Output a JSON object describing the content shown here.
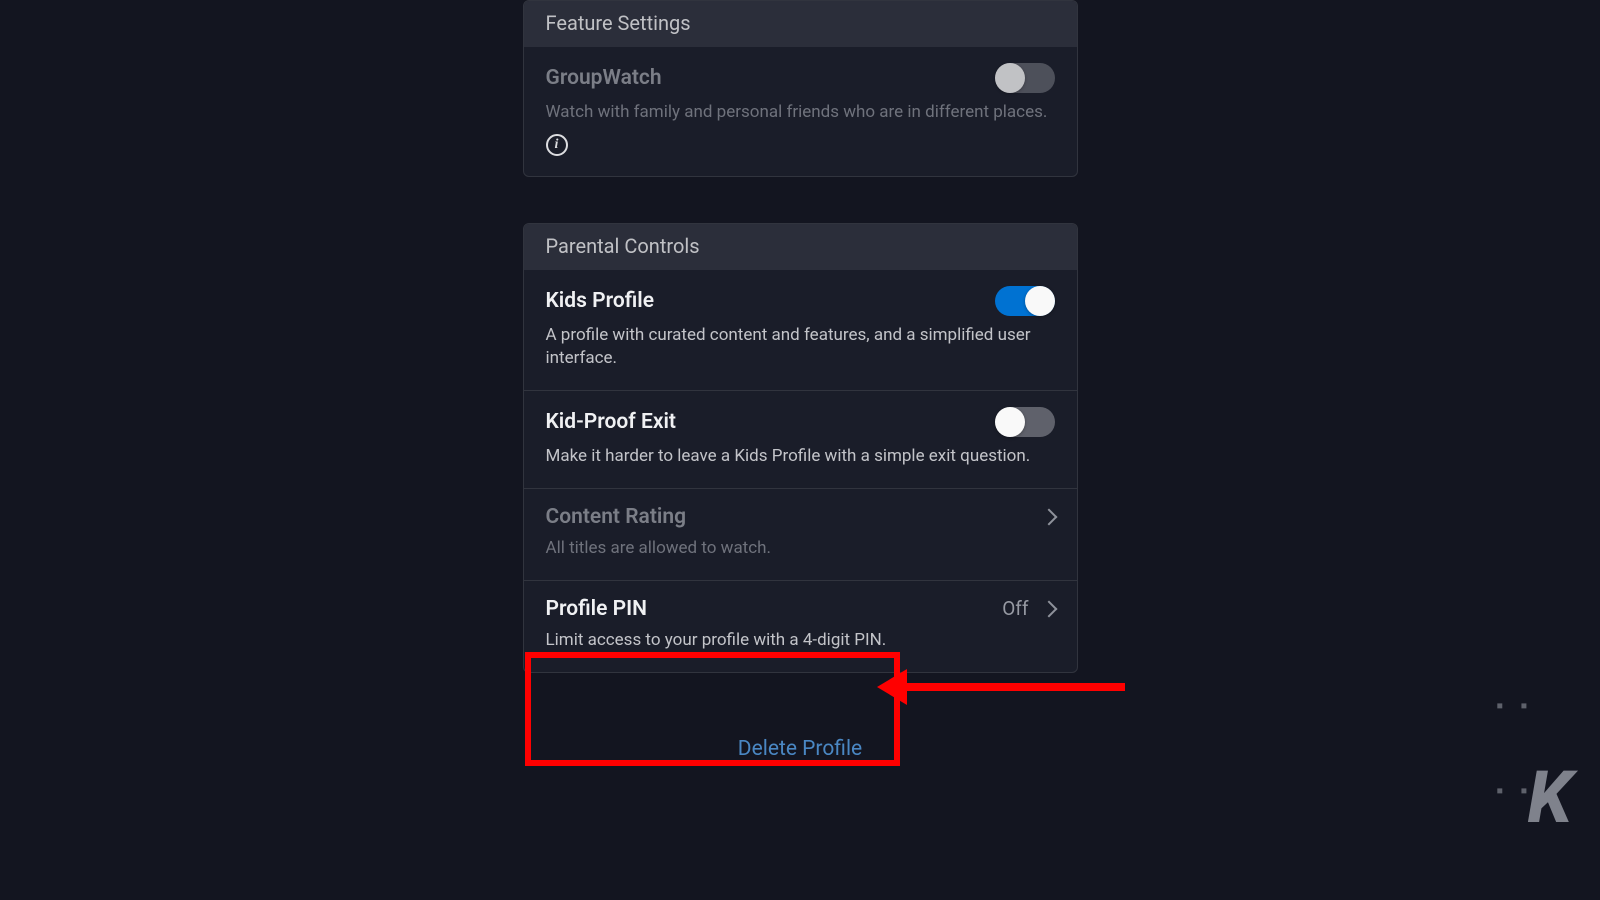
{
  "feature_settings": {
    "header": "Feature Settings",
    "groupwatch": {
      "title": "GroupWatch",
      "desc": "Watch with family and personal friends who are in different places.",
      "enabled": false
    }
  },
  "parental_controls": {
    "header": "Parental Controls",
    "kids_profile": {
      "title": "Kids Profile",
      "desc": "A profile with curated content and features, and a simplified user interface.",
      "enabled": true
    },
    "kid_proof_exit": {
      "title": "Kid-Proof Exit",
      "desc": "Make it harder to leave a Kids Profile with a simple exit question.",
      "enabled": false
    },
    "content_rating": {
      "title": "Content Rating",
      "desc": "All titles are allowed to watch."
    },
    "profile_pin": {
      "title": "Profile PIN",
      "desc": "Limit access to your profile with a 4-digit PIN.",
      "status": "Off"
    }
  },
  "footer": {
    "delete_profile": "Delete Profile"
  },
  "watermark": "K"
}
